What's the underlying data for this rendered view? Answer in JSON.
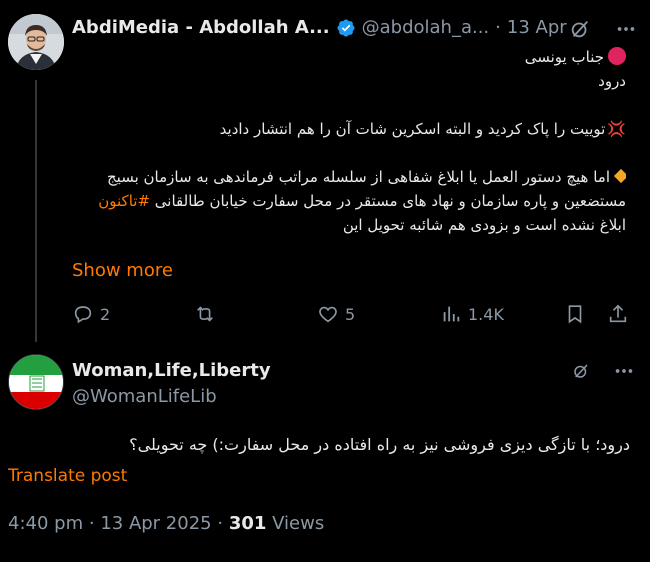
{
  "post1": {
    "author_name": "AbdiMedia - Abdollah A...",
    "handle": "@abdolah_a...",
    "separator": "·",
    "date": "13 Apr",
    "lines": [
      "جناب یونسی",
      "درود",
      "",
      "توییت را پاک کردید و البته اسکرین شات آن را هم انتشار دادید",
      "",
      "اما هیچ دستور العمل یا ابلاغ شفاهی از سلسله مراتب فرماندهی به سازمان بسیج",
      "مستضعین و پاره سازمان و نهاد های مستقر در محل سفارت خیابان طالقانی",
      "ابلاغ نشده است و بزودی هم شائبه تحویل این"
    ],
    "anger_symbol": "💢",
    "hashtag": "#تاکنون",
    "show_more": "Show more",
    "actions": {
      "replies": "2",
      "reposts": "",
      "likes": "5",
      "views": "1.4K"
    }
  },
  "post2": {
    "author_name": "Woman,Life,Liberty",
    "handle": "@WomanLifeLib",
    "text": "درود؛ با تازگی دیزی فروشی نیز به راه افتاده در محل سفارت:) چه تحویلی؟",
    "translate_label": "Translate post",
    "time": "4:40 pm",
    "date": "13 Apr 2025",
    "separator": "·",
    "views_count": "301",
    "views_label": "Views"
  },
  "colors": {
    "background": "#000000",
    "text_primary": "#e7e9ea",
    "text_secondary": "#8b98a5",
    "accent": "#ff7a00",
    "verified_blue": "#1d9bf0"
  },
  "icons": [
    "verified-badge-icon",
    "grok-icon",
    "reply-icon",
    "repost-icon",
    "like-icon",
    "views-icon",
    "bookmark-icon",
    "share-icon",
    "iran-flag-icon"
  ]
}
